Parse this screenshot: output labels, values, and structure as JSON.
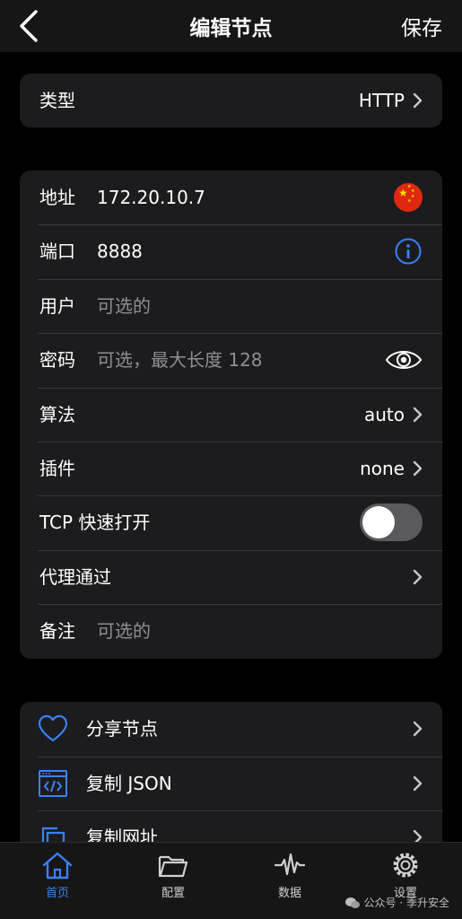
{
  "nav": {
    "title": "编辑节点",
    "save": "保存"
  },
  "type_row": {
    "label": "类型",
    "value": "HTTP"
  },
  "form": {
    "address": {
      "label": "地址",
      "value": "172.20.10.7"
    },
    "port": {
      "label": "端口",
      "value": "8888"
    },
    "user": {
      "label": "用户",
      "placeholder": "可选的"
    },
    "password": {
      "label": "密码",
      "placeholder": "可选，最大长度 128"
    },
    "algorithm": {
      "label": "算法",
      "value": "auto"
    },
    "plugin": {
      "label": "插件",
      "value": "none"
    },
    "tcp_fast_open": {
      "label": "TCP 快速打开",
      "enabled": false
    },
    "proxy_via": {
      "label": "代理通过"
    },
    "remark": {
      "label": "备注",
      "placeholder": "可选的"
    }
  },
  "actions": [
    {
      "label": "分享节点",
      "icon": "heart-icon"
    },
    {
      "label": "复制 JSON",
      "icon": "code-window-icon"
    },
    {
      "label": "复制网址",
      "icon": "copy-icon"
    }
  ],
  "tabs": [
    {
      "label": "首页",
      "icon": "home-icon",
      "active": true
    },
    {
      "label": "配置",
      "icon": "folder-icon",
      "active": false
    },
    {
      "label": "数据",
      "icon": "waveform-icon",
      "active": false
    },
    {
      "label": "设置",
      "icon": "gear-icon",
      "active": false
    }
  ],
  "watermark": "公众号 · 季升安全",
  "colors": {
    "accent": "#3a82f7",
    "card": "#1c1c1e",
    "background": "#000000"
  }
}
